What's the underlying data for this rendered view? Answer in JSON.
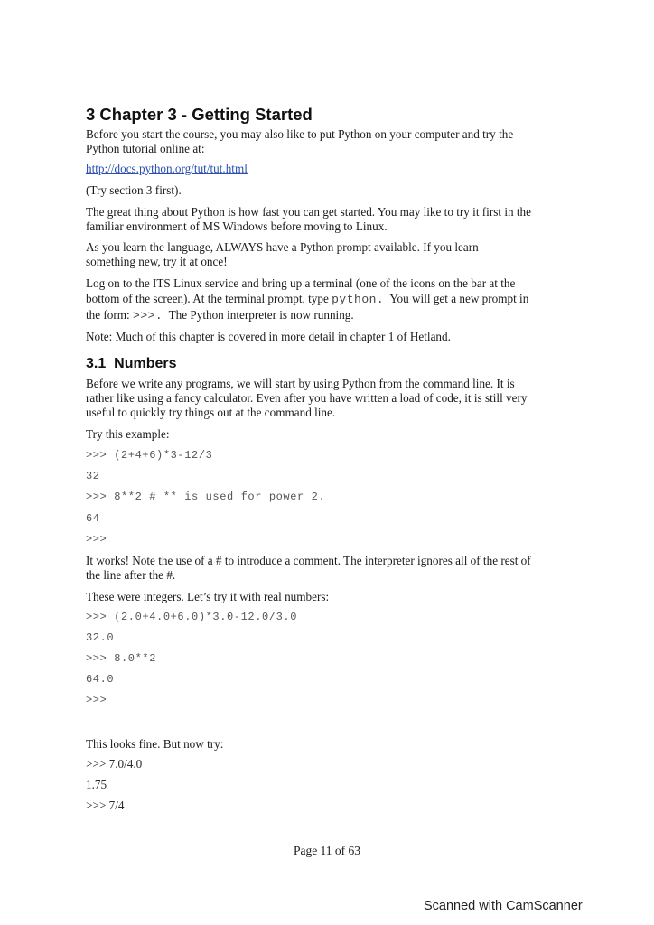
{
  "chapter": {
    "title": "3 Chapter 3 - Getting Started",
    "intro_line1": "Before you start the course, you may also like to put Python on your computer and try the",
    "intro_line2": "Python tutorial online at:",
    "link": "http://docs.python.org/tut/tut.html",
    "try_section": "(Try section 3 first).",
    "para2_line1": "The great thing about Python is how fast you can get started. You may like to try it first in the",
    "para2_line2": "familiar environment of MS Windows before moving to Linux.",
    "para3_line1": "As you learn the language, ALWAYS have a Python prompt available. If you learn",
    "para3_line2": "something new, try it at once!",
    "para4_line1": "Log on to the ITS Linux service and bring up a terminal (one of the icons on the bar at the",
    "para4_line2_a": "bottom of the screen). At the terminal prompt, type ",
    "para4_line2_code": "python.",
    "para4_line2_b": "  You will get a new prompt in",
    "para4_line3_a": "the form: ",
    "para4_line3_code": ">>>.",
    "para4_line3_b": "  The Python interpreter is now running.",
    "note": "Note: Much of this chapter is covered in more detail in chapter 1 of Hetland."
  },
  "section": {
    "title": "3.1  Numbers",
    "para1_line1": "Before we write any programs, we will start by using Python from the command line. It is",
    "para1_line2": "rather like using a fancy calculator. Even after you have written a load of code, it is still very",
    "para1_line3": "useful to quickly try things out at the command line.",
    "try_example": "Try this example:",
    "code1": [
      ">>> (2+4+6)*3-12/3",
      "32",
      ">>> 8**2 # ** is used for power 2.",
      "64",
      ">>>"
    ],
    "works_line1": "It works! Note the use of a # to introduce a comment. The interpreter ignores all of the rest of",
    "works_line2": "the line after the #.",
    "integers": "These were integers. Let’s try it with real numbers:",
    "code2": [
      ">>> (2.0+4.0+6.0)*3.0-12.0/3.0",
      "32.0",
      ">>> 8.0**2",
      "64.0",
      ">>>"
    ],
    "looks_fine": "This looks fine. But now try:",
    "code3": [
      ">>> 7.0/4.0",
      "1.75",
      ">>> 7/4"
    ]
  },
  "footer": {
    "page": "Page 11 of 63"
  },
  "watermark": "Scanned with CamScanner"
}
